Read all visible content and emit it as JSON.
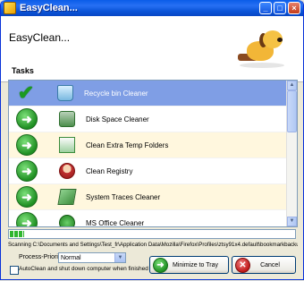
{
  "window": {
    "title": "EasyClean...",
    "controls": {
      "minimize": "_",
      "maximize": "□",
      "close": "×"
    }
  },
  "header": {
    "title": "EasyClean...",
    "logo_icon": "dog-mascot-icon"
  },
  "tasks": {
    "label": "Tasks",
    "items": [
      {
        "label": "Recycle bin Cleaner",
        "status": "done",
        "icon": "recycle-bin-icon"
      },
      {
        "label": "Disk Space Cleaner",
        "status": "pending",
        "icon": "disk-icon"
      },
      {
        "label": "Clean Extra Temp Folders",
        "status": "pending",
        "icon": "folders-icon"
      },
      {
        "label": "Clean Registry",
        "status": "pending",
        "icon": "registry-icon"
      },
      {
        "label": "System Traces Cleaner",
        "status": "pending",
        "icon": "traces-icon"
      },
      {
        "label": "MS Office Cleaner",
        "status": "pending",
        "icon": "office-icon"
      }
    ]
  },
  "progress": {
    "percent": 5
  },
  "status": {
    "scan_text": "Scanning C:\\Documents and Settings\\Test_fr\\Application Data\\Mozilla\\Firefox\\Profiles\\ztsy91x4.default\\bookmarkbackups"
  },
  "priority": {
    "label": "Process-Priority:",
    "value": "Normal"
  },
  "auto_shutdown": {
    "label": "AutoClean and shut down computer when finished",
    "checked": false
  },
  "buttons": {
    "minimize_label": "Minimize to Tray",
    "cancel_label": "Cancel"
  },
  "colors": {
    "selected_row": "#7f9ee5",
    "alt_row": "#fff7de",
    "progress": "#2fb62f"
  }
}
